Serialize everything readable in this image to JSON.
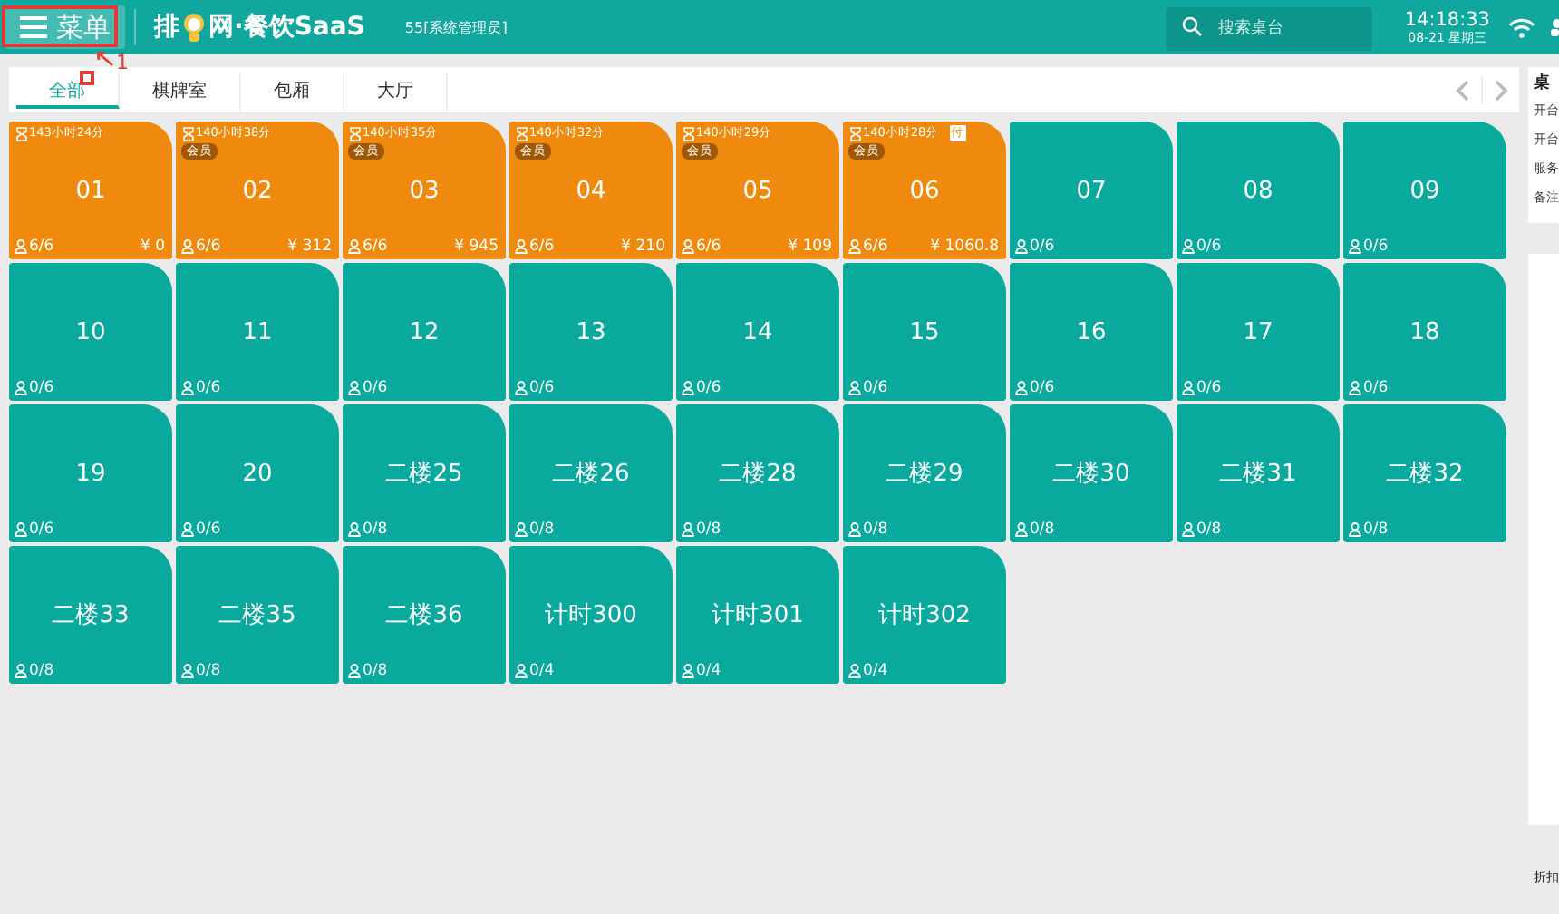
{
  "header": {
    "menu_button": "菜单",
    "logo_left": "排",
    "logo_right": "网·餐饮SaaS",
    "user": "55[系统管理员]",
    "search": {
      "placeholder": "搜索桌台"
    },
    "time": "14:18:33",
    "date": "08-21 星期三"
  },
  "annotation": {
    "label": "1"
  },
  "tabs": [
    {
      "label": "全部",
      "selected": true
    },
    {
      "label": "棋牌室",
      "selected": false
    },
    {
      "label": "包厢",
      "selected": false
    },
    {
      "label": "大厅",
      "selected": false
    }
  ],
  "tables": [
    {
      "name": "01",
      "kind": "occupied",
      "duration": "143小时24分",
      "guests": "6/6",
      "amount": "¥ 0"
    },
    {
      "name": "02",
      "kind": "occupied",
      "duration": "140小时38分",
      "member_label": "会员",
      "guests": "6/6",
      "amount": "¥ 312"
    },
    {
      "name": "03",
      "kind": "occupied",
      "duration": "140小时35分",
      "member_label": "会员",
      "guests": "6/6",
      "amount": "¥ 945"
    },
    {
      "name": "04",
      "kind": "occupied",
      "duration": "140小时32分",
      "member_label": "会员",
      "guests": "6/6",
      "amount": "¥ 210"
    },
    {
      "name": "05",
      "kind": "occupied",
      "duration": "140小时29分",
      "member_label": "会员",
      "guests": "6/6",
      "amount": "¥ 109"
    },
    {
      "name": "06",
      "kind": "occupied",
      "duration": "140小时28分",
      "member_label": "会员",
      "paid_label": "付",
      "guests": "6/6",
      "amount": "¥ 1060.8"
    },
    {
      "name": "07",
      "kind": "free",
      "guests": "0/6"
    },
    {
      "name": "08",
      "kind": "free",
      "guests": "0/6"
    },
    {
      "name": "09",
      "kind": "free",
      "guests": "0/6"
    },
    {
      "name": "10",
      "kind": "free",
      "guests": "0/6"
    },
    {
      "name": "11",
      "kind": "free",
      "guests": "0/6"
    },
    {
      "name": "12",
      "kind": "free",
      "guests": "0/6"
    },
    {
      "name": "13",
      "kind": "free",
      "guests": "0/6"
    },
    {
      "name": "14",
      "kind": "free",
      "guests": "0/6"
    },
    {
      "name": "15",
      "kind": "free",
      "guests": "0/6"
    },
    {
      "name": "16",
      "kind": "free",
      "guests": "0/6"
    },
    {
      "name": "17",
      "kind": "free",
      "guests": "0/6"
    },
    {
      "name": "18",
      "kind": "free",
      "guests": "0/6"
    },
    {
      "name": "19",
      "kind": "free",
      "guests": "0/6"
    },
    {
      "name": "20",
      "kind": "free",
      "guests": "0/6"
    },
    {
      "name": "二楼25",
      "kind": "free",
      "guests": "0/8"
    },
    {
      "name": "二楼26",
      "kind": "free",
      "guests": "0/8"
    },
    {
      "name": "二楼28",
      "kind": "free",
      "guests": "0/8"
    },
    {
      "name": "二楼29",
      "kind": "free",
      "guests": "0/8"
    },
    {
      "name": "二楼30",
      "kind": "free",
      "guests": "0/8"
    },
    {
      "name": "二楼31",
      "kind": "free",
      "guests": "0/8"
    },
    {
      "name": "二楼32",
      "kind": "free",
      "guests": "0/8"
    },
    {
      "name": "二楼33",
      "kind": "free",
      "guests": "0/8"
    },
    {
      "name": "二楼35",
      "kind": "free",
      "guests": "0/8"
    },
    {
      "name": "二楼36",
      "kind": "free",
      "guests": "0/8"
    },
    {
      "name": "计时300",
      "kind": "free",
      "guests": "0/4"
    },
    {
      "name": "计时301",
      "kind": "free",
      "guests": "0/4"
    },
    {
      "name": "计时302",
      "kind": "free",
      "guests": "0/4"
    }
  ],
  "side_panel": {
    "title": "桌",
    "rows": [
      "开台",
      "开台",
      "服务",
      "备注"
    ],
    "footer": "折扣"
  }
}
